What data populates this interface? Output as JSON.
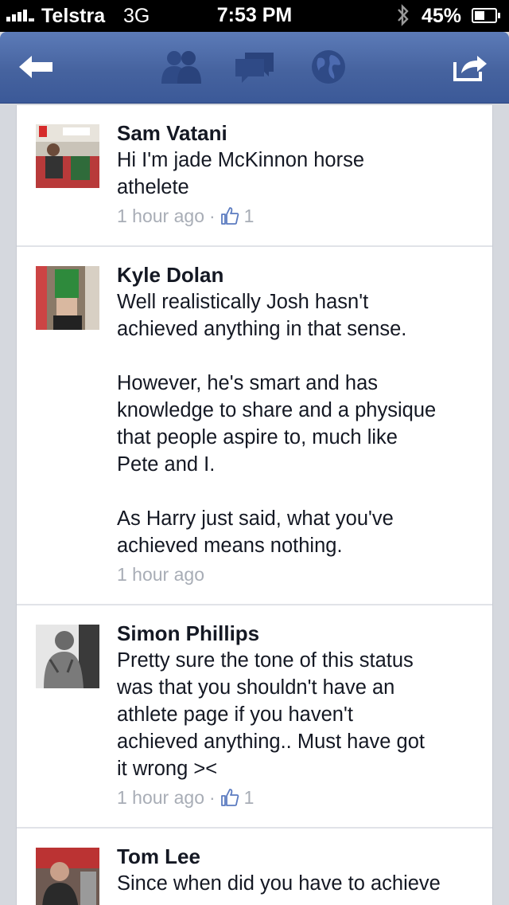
{
  "status_bar": {
    "carrier": "Telstra",
    "network": "3G",
    "time": "7:53 PM",
    "battery": "45%"
  },
  "nav": {
    "icons": [
      "back-arrow-icon",
      "friends-icon",
      "messages-icon",
      "globe-icon",
      "share-icon"
    ]
  },
  "comments": [
    {
      "author": "Sam Vatani",
      "text": "Hi I'm jade McKinnon horse\nathelete",
      "time": "1 hour ago",
      "likes": "1"
    },
    {
      "author": "Kyle Dolan",
      "text": "Well realistically Josh hasn't\nachieved anything in that sense.\n\nHowever, he's smart and has\nknowledge to share and a physique\nthat people aspire to, much like\nPete and I.\n\nAs Harry just said, what you've\nachieved means nothing.",
      "time": "1 hour ago"
    },
    {
      "author": "Simon Phillips",
      "text": "Pretty sure the tone of this status\nwas that you shouldn't have an\nathlete page if you haven't\nachieved anything.. Must have got\nit wrong ><",
      "time": "1 hour ago",
      "likes": "1"
    },
    {
      "author": "Tom Lee",
      "text": "Since when did you have to achieve"
    }
  ],
  "colors": {
    "nav_blue": "#3b5998",
    "meta_gray": "#a8adb6",
    "like_blue": "#5b7bc0"
  }
}
